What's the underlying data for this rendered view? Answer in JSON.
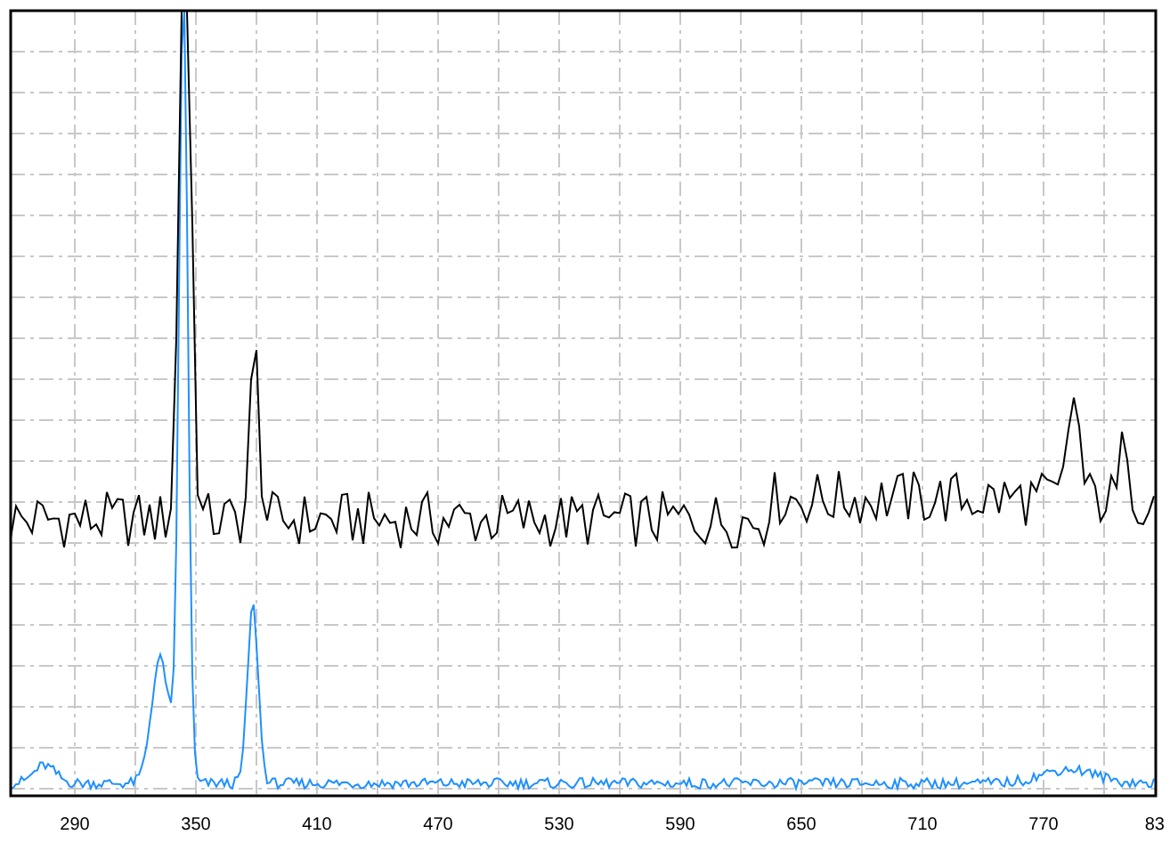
{
  "plot": {
    "x_tick_labels": [
      "290",
      "350",
      "410",
      "470",
      "530",
      "590",
      "650",
      "710",
      "770",
      "83"
    ]
  }
}
